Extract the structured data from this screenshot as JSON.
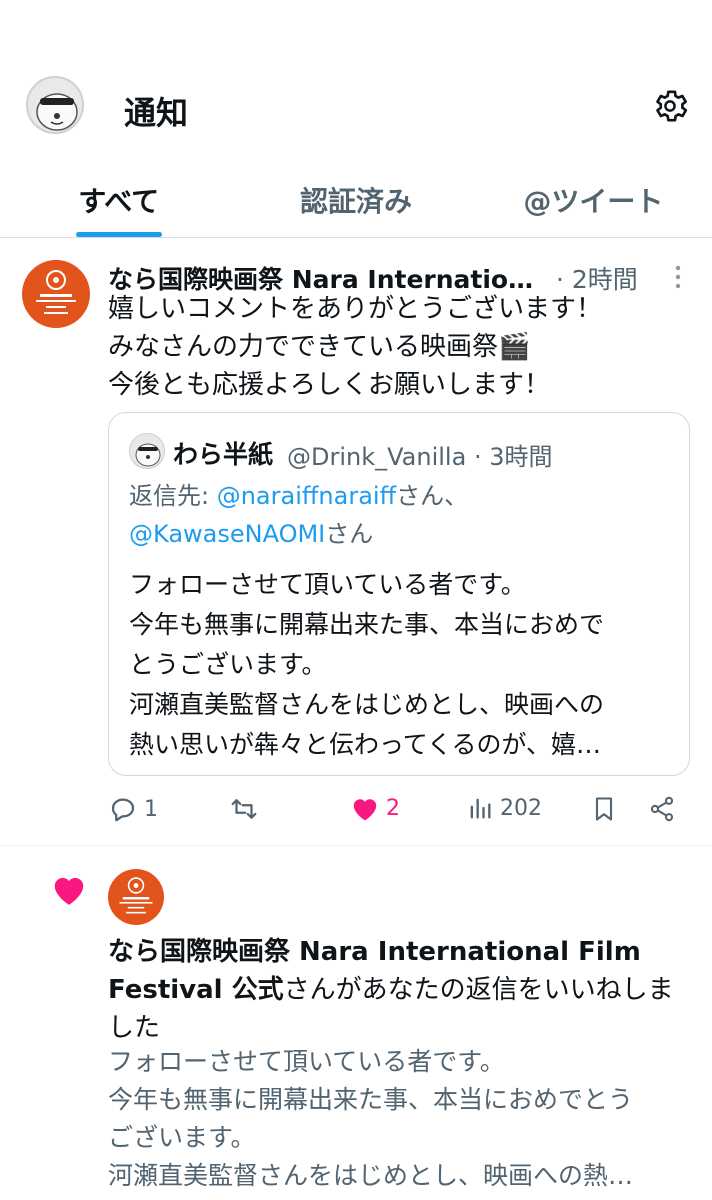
{
  "header": {
    "title": "通知"
  },
  "tabs": [
    {
      "label": "すべて"
    },
    {
      "label": "認証済み"
    },
    {
      "label": "@ツイート"
    }
  ],
  "tweet": {
    "author": "なら国際映画祭 Nara Internation…",
    "time": " · 2時間",
    "body": [
      "嬉しいコメントをありがとうございます！",
      "みなさんの力でできている映画祭🎬",
      "今後とも応援よろしくお願いします！"
    ],
    "quote": {
      "name": "わら半紙",
      "handle_time": "@Drink_Vanilla · 3時間",
      "reply_prefix": "返信先: ",
      "reply_user1": "@naraiffnaraiff",
      "reply_suffix1": "さん、",
      "reply_user2": "@KawaseNAOMI",
      "reply_suffix2": "さん",
      "body": [
        "フォローさせて頂いている者です。",
        "今年も無事に開幕出来た事、本当におめで",
        "とうございます。",
        "河瀬直美監督さんをはじめとし、映画への",
        "熱い思いが犇々と伝わってくるのが、嬉…"
      ]
    },
    "actions": {
      "replies": "1",
      "retweets": "",
      "likes": "2",
      "views": "202"
    }
  },
  "notification": {
    "line1": "なら国際映画祭 Nara International Film",
    "line2_bold": "Festival 公式",
    "line2_rest": "さんがあなたの返信をいいねしま",
    "line3": "した",
    "preview": [
      "フォローさせて頂いている者です。",
      "今年も無事に開幕出来た事、本当におめでとう",
      "ございます。",
      "河瀬直美監督さんをはじめとし、映画への熱…"
    ]
  },
  "colors": {
    "accent": "#1d9bf0",
    "like": "#f91880",
    "secondary_text": "#536471",
    "nara_orange": "#e2541c"
  },
  "icons": [
    "settings-icon",
    "more-icon",
    "reply-icon",
    "retweet-icon",
    "heart-icon",
    "views-icon",
    "bookmark-icon",
    "share-icon"
  ]
}
